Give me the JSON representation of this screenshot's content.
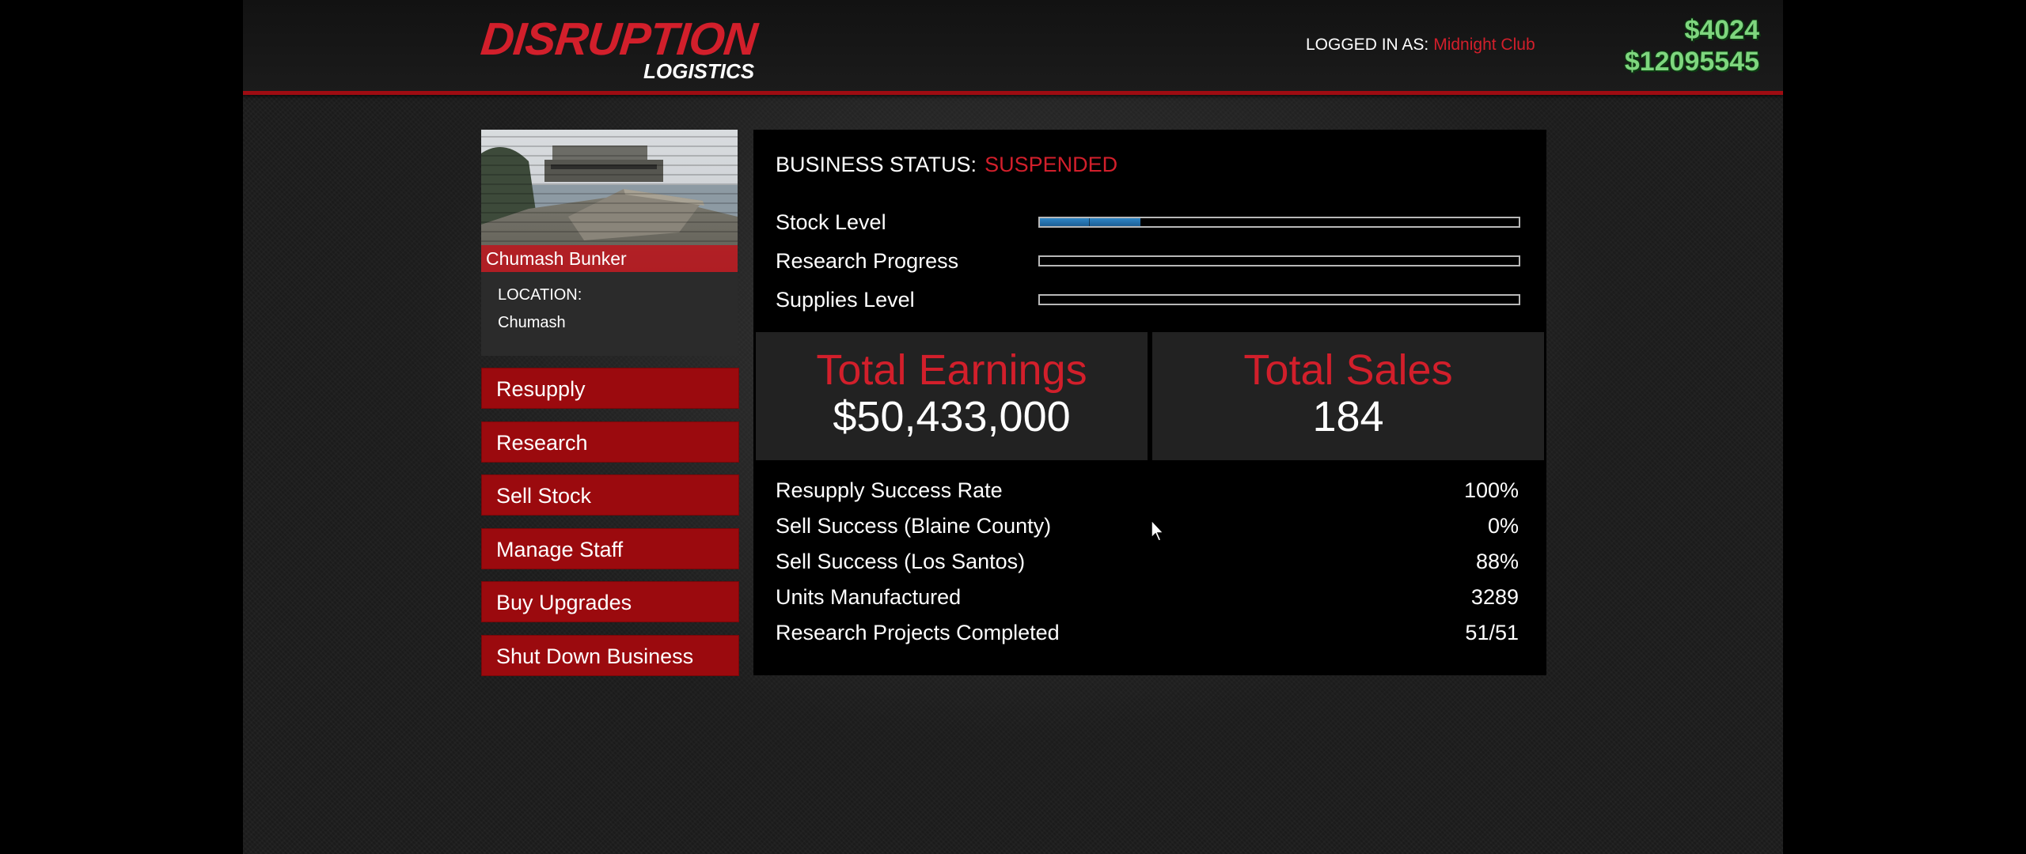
{
  "header": {
    "logo_main": "DISRUPTION",
    "logo_sub": "LOGISTICS",
    "logged_in_label": "LOGGED IN AS:",
    "logged_in_name": "Midnight Club",
    "wallet": "$4024",
    "bank": "$12095545"
  },
  "business": {
    "name": "Chumash Bunker",
    "location_label": "LOCATION:",
    "location": "Chumash"
  },
  "menu": [
    "Resupply",
    "Research",
    "Sell Stock",
    "Manage Staff",
    "Buy Upgrades",
    "Shut Down Business"
  ],
  "status": {
    "label": "BUSINESS STATUS:",
    "value": "SUSPENDED"
  },
  "bars": [
    {
      "label": "Stock Level",
      "fraction": 0.21
    },
    {
      "label": "Research Progress",
      "fraction": 0
    },
    {
      "label": "Supplies Level",
      "fraction": 0
    }
  ],
  "tiles": {
    "earnings_title": "Total Earnings",
    "earnings_value": "$50,433,000",
    "sales_title": "Total Sales",
    "sales_value": "184"
  },
  "stats": [
    {
      "label": "Resupply Success Rate",
      "value": "100%"
    },
    {
      "label": "Sell Success (Blaine County)",
      "value": "0%"
    },
    {
      "label": "Sell Success (Los Santos)",
      "value": "88%"
    },
    {
      "label": "Units Manufactured",
      "value": "3289"
    },
    {
      "label": "Research Projects Completed",
      "value": "51/51"
    }
  ],
  "colors": {
    "accent_red": "#d21f2b",
    "button_red": "#9b0a0e",
    "money_green": "#7ed67e",
    "bar_blue": "#2f86c6"
  }
}
